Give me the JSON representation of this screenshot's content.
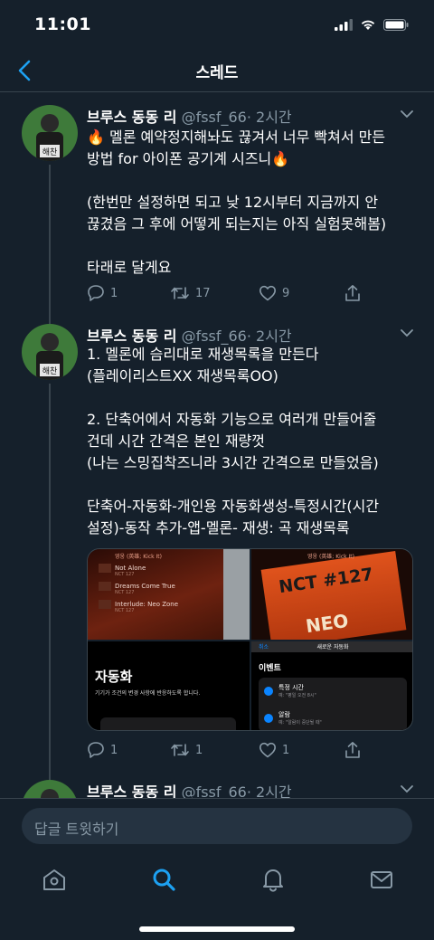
{
  "status_bar": {
    "time": "11:01"
  },
  "nav": {
    "title": "스레드"
  },
  "tweets": [
    {
      "name": "브루스 동동 리",
      "handle": "@fssf_66",
      "time": "· 2시간",
      "avatar_label": "해찬",
      "lines": [
        "🔥 멜론 예약정지해놔도 끊겨서 너무 빡쳐서 만든",
        "방법 for 아이폰 공기계 시즈니🔥",
        "",
        "(한번만 설정하면 되고 낮 12시부터 지금까지 안",
        "끊겼음 그 후에 어떻게 되는지는 아직 실험못해봄)",
        "",
        "타래로 달게요"
      ],
      "replies": "1",
      "retweets": "17",
      "likes": "9"
    },
    {
      "name": "브루스 동동 리",
      "handle": "@fssf_66",
      "time": "· 2시간",
      "avatar_label": "해찬",
      "lines": [
        "1. 멜론에 슴리대로 재생목록을 만든다",
        "(플레이리스트XX 재생목록OO)",
        "",
        "2. 단축어에서 자동화 기능으로 여러개 만들어줄",
        "건데 시간 간격은 본인 재량껏",
        "(나는 스밍집착즈니라 3시간 간격으로 만들었음)",
        "",
        "단축어-자동화-개인용 자동화생성-특정시간(시간",
        "설정)-동작 추가-앱-멜론- 재생: 곡 재생목록"
      ],
      "media": {
        "playlist": [
          {
            "title": "Not Alone",
            "artist": "NCT 127"
          },
          {
            "title": "Dreams Come True",
            "artist": "NCT 127"
          },
          {
            "title": "Interlude: Neo Zone",
            "artist": "NCT 127"
          }
        ],
        "now_playing": "영웅 (英雄; Kick It)",
        "album_text": "NCT #127",
        "album_sub": "NEO",
        "auto_title": "자동화",
        "auto_desc": "기기가 조건의 변경 사항에 반응하도록 합니다.",
        "new_auto_header": "새로운 자동화",
        "new_auto_back": "취소",
        "event_title": "이벤트",
        "events": [
          {
            "title": "특정 시간",
            "desc": "예: \"평일 오전 8시\""
          },
          {
            "title": "알람",
            "desc": "예: \"알람이 중단될 때\""
          }
        ]
      },
      "replies": "1",
      "retweets": "1",
      "likes": "1"
    },
    {
      "name": "브루스 동동 리",
      "handle": "@fssf_66",
      "time": "· 2시간"
    }
  ],
  "reply": {
    "placeholder": "답글 트윗하기"
  },
  "colors": {
    "background": "#15202b",
    "accent": "#1da1f2",
    "muted": "#8899a6",
    "divider": "#38444d"
  },
  "icons": [
    "back-chevron-icon",
    "chevron-down-icon",
    "reply-icon",
    "retweet-icon",
    "like-icon",
    "share-icon",
    "home-icon",
    "search-icon",
    "notifications-icon",
    "messages-icon"
  ]
}
